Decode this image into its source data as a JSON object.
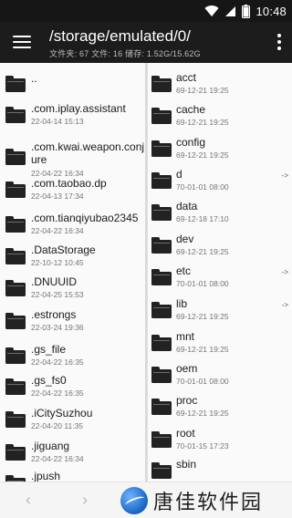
{
  "status_bar": {
    "time": "10:48"
  },
  "app_bar": {
    "path": "/storage/emulated/0/",
    "stats": "文件夹: 67  文件: 16  储存: 1.52G/15.62G"
  },
  "left_pane": [
    {
      "name": "..",
      "date": ""
    },
    {
      "name": ".com.iplay.assistant",
      "date": "22-04-14 15:13"
    },
    {
      "name": ".com.kwai.weapon.conjure",
      "date": "22-04-22 16:34"
    },
    {
      "name": ".com.taobao.dp",
      "date": "22-04-13 17:34"
    },
    {
      "name": ".com.tianqiyubao2345",
      "date": "22-04-22 16:34"
    },
    {
      "name": ".DataStorage",
      "date": "22-10-12 10:45"
    },
    {
      "name": ".DNUUID",
      "date": "22-04-25 15:53"
    },
    {
      "name": ".estrongs",
      "date": "22-03-24 19:36"
    },
    {
      "name": ".gs_file",
      "date": "22-04-22 16:35"
    },
    {
      "name": ".gs_fs0",
      "date": "22-04-22 16:35"
    },
    {
      "name": ".iCitySuzhou",
      "date": "22-04-20 11:35"
    },
    {
      "name": ".jiguang",
      "date": "22-04-22 16:34"
    },
    {
      "name": ".jpush",
      "date": ""
    }
  ],
  "right_pane": [
    {
      "name": "acct",
      "date": "69-12-21 19:25",
      "link": ""
    },
    {
      "name": "cache",
      "date": "69-12-21 19:25",
      "link": ""
    },
    {
      "name": "config",
      "date": "69-12-21 19:25",
      "link": ""
    },
    {
      "name": "d",
      "date": "70-01-01 08:00",
      "link": "->"
    },
    {
      "name": "data",
      "date": "69-12-18 17:10",
      "link": ""
    },
    {
      "name": "dev",
      "date": "69-12-21 19:25",
      "link": ""
    },
    {
      "name": "etc",
      "date": "70-01-01 08:00",
      "link": "->"
    },
    {
      "name": "lib",
      "date": "69-12-21 19:25",
      "link": "->"
    },
    {
      "name": "mnt",
      "date": "69-12-21 19:25",
      "link": ""
    },
    {
      "name": "oem",
      "date": "70-01-01 08:00",
      "link": ""
    },
    {
      "name": "proc",
      "date": "69-12-21 19:25",
      "link": ""
    },
    {
      "name": "root",
      "date": "70-01-15 17:23",
      "link": ""
    },
    {
      "name": "sbin",
      "date": "",
      "link": ""
    }
  ],
  "bottom_bar": {
    "back_arrow": "‹",
    "forward_arrow": "›",
    "watermark_text": "唐佳软件园"
  },
  "icons": {
    "wifi": "wifi-icon",
    "signal": "signal-icon",
    "battery": "battery-icon",
    "menu": "hamburger-menu-icon",
    "overflow": "overflow-menu-icon",
    "folder": "folder-icon"
  }
}
